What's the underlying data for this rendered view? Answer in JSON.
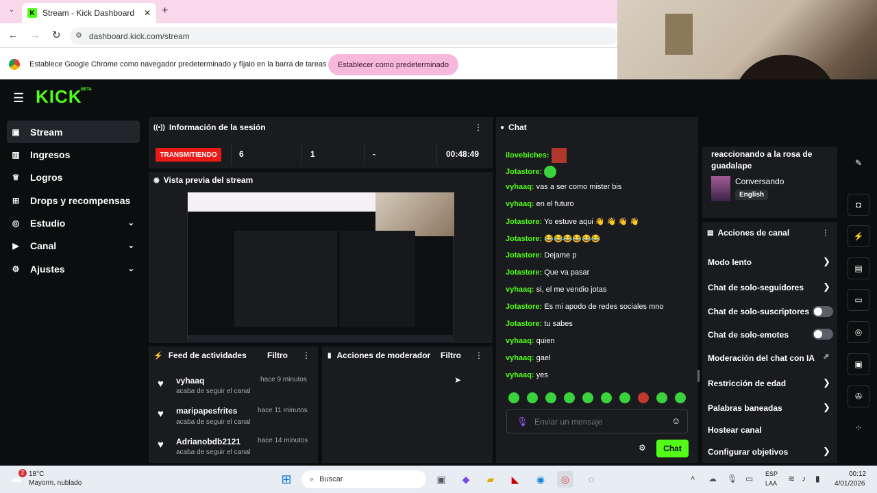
{
  "browser": {
    "tab_title": "Stream - Kick Dashboard",
    "tab_icon": "kick-favicon",
    "new_tab": "+",
    "url": "dashboard.kick.com/stream",
    "infobar_text": "Establece Google Chrome como navegador predeterminado y fíjalo en la barra de tareas",
    "infobar_button": "Establecer como predeterminado"
  },
  "app": {
    "logo": "KICK",
    "logo_badge": "BETA",
    "accent": "#53fc18",
    "nav": [
      {
        "label": "Stream",
        "icon": "video-icon"
      },
      {
        "label": "Ingresos",
        "icon": "chart-icon"
      },
      {
        "label": "Logros",
        "icon": "trophy-icon"
      },
      {
        "label": "Drops y recompensas",
        "icon": "gift-icon"
      },
      {
        "label": "Estudio",
        "icon": "studio-icon"
      },
      {
        "label": "Canal",
        "icon": "channel-icon"
      },
      {
        "label": "Ajustes",
        "icon": "gear-icon"
      }
    ]
  },
  "session": {
    "title": "Información de la sesión",
    "status": "TRANSMITIENDO",
    "viewers": "6",
    "followers": "1",
    "subs": "-",
    "duration": "00:48:49"
  },
  "preview": {
    "title": "Vista previa del stream"
  },
  "activity": {
    "title": "Feed de actividades",
    "filter": "Filtro",
    "items": [
      {
        "user": "vyhaaq",
        "time": "hace 9 minutos",
        "action": "acaba de seguir el canal"
      },
      {
        "user": "maripapesfrites",
        "time": "hace 11 minutos",
        "action": "acaba de seguir el canal"
      },
      {
        "user": "Adrianobdb2121",
        "time": "hace 14 minutos",
        "action": "acaba de seguir el canal"
      }
    ]
  },
  "moderator": {
    "title": "Acciones de moderador",
    "filter": "Filtro"
  },
  "chat": {
    "title": "Chat",
    "messages": [
      {
        "user": "ilovebiches:",
        "text": ""
      },
      {
        "user": "Jotastore:",
        "text": ""
      },
      {
        "user": "vyhaaq:",
        "text": "vas a ser como mister bis"
      },
      {
        "user": "vyhaaq:",
        "text": "en el futuro"
      },
      {
        "user": "Jotastore:",
        "text": "Yo estuve aqui"
      },
      {
        "user": "Jotastore:",
        "text": ""
      },
      {
        "user": "Jotastore:",
        "text": "Dejame p"
      },
      {
        "user": "Jotastore:",
        "text": "Que va pasar"
      },
      {
        "user": "vyhaaq:",
        "text": "si, el me vendio jotas"
      },
      {
        "user": "Jotastore:",
        "text": "Es mi apodo de redes sociales mno"
      },
      {
        "user": "Jotastore:",
        "text": "tu sabes"
      },
      {
        "user": "vyhaaq:",
        "text": "quien"
      },
      {
        "user": "vyhaaq:",
        "text": "gael"
      },
      {
        "user": "vyhaaq:",
        "text": "yes"
      }
    ],
    "input_placeholder": "Enviar un mensaje",
    "send_label": "Chat"
  },
  "stream_info": {
    "title_line1": "reaccionando a la rosa de",
    "title_line2": "guadalape",
    "category": "Conversando",
    "language": "English"
  },
  "channel_actions": {
    "title": "Acciones de canal",
    "items": [
      {
        "label": "Modo lento",
        "control": "arrow"
      },
      {
        "label": "Chat de solo-seguidores",
        "control": "arrow"
      },
      {
        "label": "Chat de solo-suscriptores",
        "control": "toggle"
      },
      {
        "label": "Chat de solo-emotes",
        "control": "toggle"
      },
      {
        "label": "Moderación del chat con IA",
        "control": "external"
      },
      {
        "label": "Restricción de edad",
        "control": "arrow"
      },
      {
        "label": "Palabras baneadas",
        "control": "arrow"
      },
      {
        "label": "Hostear canal",
        "control": "none"
      },
      {
        "label": "Configurar objetivos",
        "control": "arrow"
      }
    ]
  },
  "taskbar": {
    "weather_temp": "18°C",
    "weather_desc": "Mayorm. nublado",
    "weather_badge": "2",
    "search": "Buscar",
    "lang1": "ESP",
    "lang2": "LAA",
    "time": "00:12",
    "date": "4/01/2026"
  }
}
